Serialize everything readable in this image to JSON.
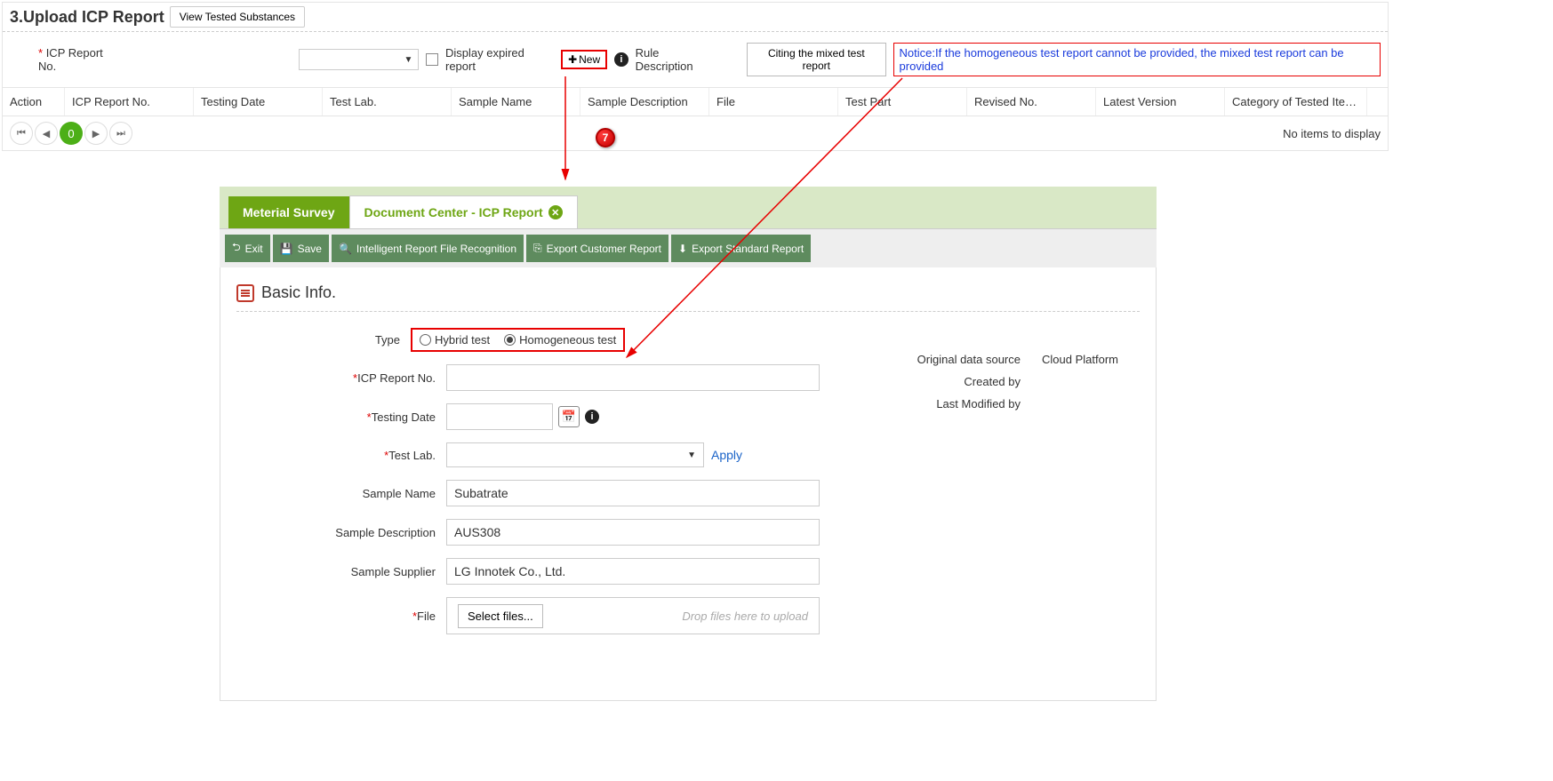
{
  "top": {
    "title": "3.Upload ICP Report",
    "view_tested_btn": "View Tested Substances",
    "icp_label": "ICP Report No.",
    "display_expired": "Display expired report",
    "new_btn": "New",
    "rule_desc": "Rule Description",
    "citing_btn": "Citing the mixed test report",
    "notice": "Notice:If the homogeneous test report cannot be provided, the mixed test report can be provided",
    "columns": {
      "action": "Action",
      "icp": "ICP Report No.",
      "tdate": "Testing Date",
      "lab": "Test Lab.",
      "sname": "Sample Name",
      "sdesc": "Sample Description",
      "file": "File",
      "tpart": "Test Part",
      "rev": "Revised No.",
      "latest": "Latest Version",
      "cat": "Category of Tested Ite…"
    },
    "pager_current": "0",
    "no_items": "No items to display"
  },
  "callouts": {
    "seven": "7"
  },
  "bottom": {
    "tab_survey": "Meterial Survey",
    "tab_doc": "Document Center - ICP Report",
    "toolbar": {
      "exit": "Exit",
      "save": "Save",
      "intel": "Intelligent Report File Recognition",
      "exp_cust": "Export Customer Report",
      "exp_std": "Export Standard Report"
    },
    "section": "Basic Info.",
    "form": {
      "type_label": "Type",
      "type_hybrid": "Hybrid test",
      "type_homog": "Homogeneous test",
      "icp_label": "ICP Report No.",
      "icp_value": "",
      "tdate_label": "Testing Date",
      "tdate_value": "",
      "lab_label": "Test Lab.",
      "lab_value": "",
      "apply": "Apply",
      "sname_label": "Sample Name",
      "sname_value": "Subatrate",
      "sdesc_label": "Sample Description",
      "sdesc_value": "AUS308",
      "ssupp_label": "Sample Supplier",
      "ssupp_value": "LG Innotek Co., Ltd.",
      "file_label": "File",
      "file_btn": "Select files...",
      "file_hint": "Drop files here to upload"
    },
    "meta": {
      "src_label": "Original data source",
      "src_value": "Cloud Platform",
      "created_label": "Created by",
      "created_value": "",
      "modified_label": "Last Modified by",
      "modified_value": ""
    }
  }
}
